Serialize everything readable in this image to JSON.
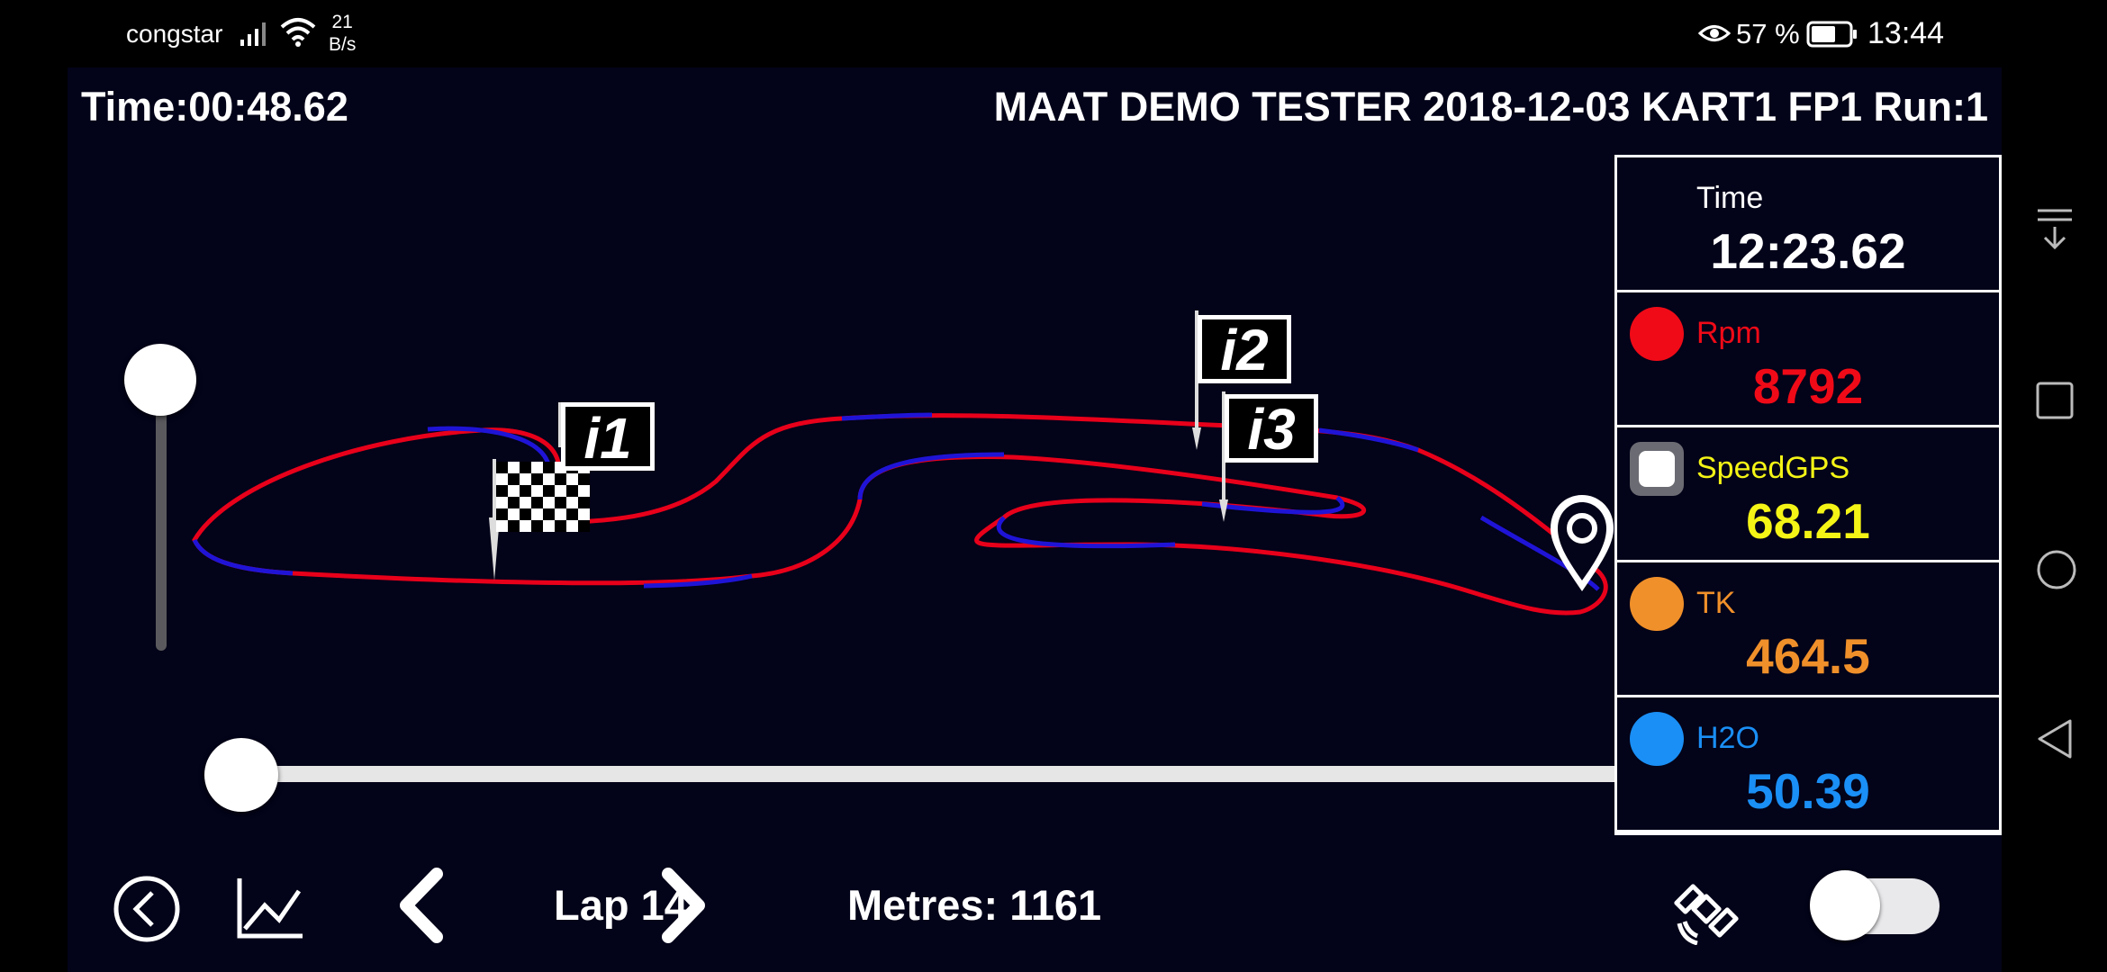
{
  "status_bar": {
    "carrier": "congstar",
    "data_rate_value": "21",
    "data_rate_unit": "B/s",
    "battery_percent": "57 %",
    "clock": "13:44",
    "icons": [
      "signal-icon",
      "wifi-icon",
      "eye-icon",
      "battery-icon"
    ]
  },
  "header": {
    "time": "Time:00:48.62",
    "session": "MAAT DEMO TESTER 2018-12-03 KART1 FP1 Run:1"
  },
  "track_map": {
    "markers": [
      {
        "name": "start-finish-flag-icon"
      },
      {
        "name": "split-i1-flag-icon",
        "label": "i1"
      },
      {
        "name": "split-i2-flag-icon",
        "label": "i2"
      },
      {
        "name": "split-i3-flag-icon",
        "label": "i3"
      },
      {
        "name": "position-pin-icon"
      }
    ],
    "colors": {
      "segment_a": "#e8001a",
      "segment_b": "#1f14d6"
    },
    "zoom_level": 1.0,
    "playback_position": 0.0
  },
  "panel": {
    "rows": [
      {
        "name": "Time",
        "value": "12:23.62",
        "color": "#ffffff"
      },
      {
        "name": "Rpm",
        "value": "8792",
        "color": "#f00a17"
      },
      {
        "name": "SpeedGPS",
        "value": "68.21",
        "color": "#f4f416"
      },
      {
        "name": "TK",
        "value": "464.5",
        "color": "#f0902a"
      },
      {
        "name": "H2O",
        "value": "50.39",
        "color": "#1a8ff5"
      }
    ]
  },
  "controls": {
    "lap": "Lap 14",
    "metres": "Metres: 1161",
    "gps_separator": ":",
    "gps_toggle_on": false,
    "icons": [
      "back-icon",
      "chart-icon",
      "prev-lap-icon",
      "next-lap-icon",
      "satellite-icon"
    ]
  },
  "nav_bar": {
    "icons": [
      "notification-pull-icon",
      "recents-icon",
      "home-icon",
      "back-nav-icon"
    ]
  }
}
